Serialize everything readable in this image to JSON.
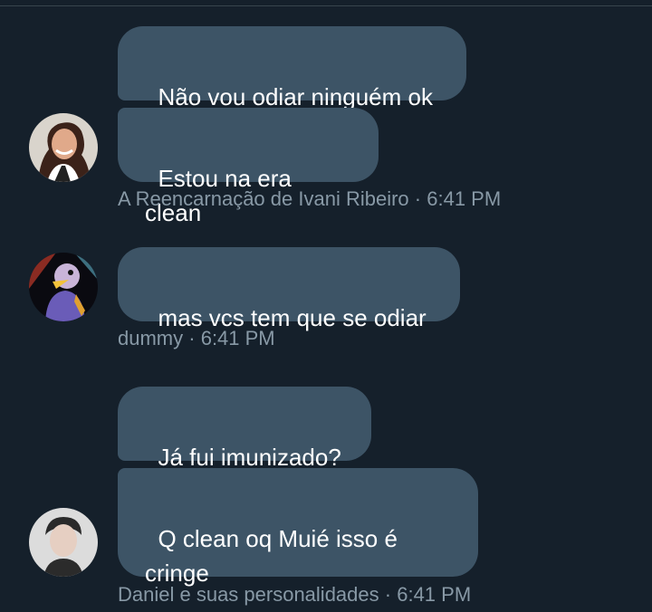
{
  "colors": {
    "background": "#15202b",
    "bubble": "#3d5466",
    "bubble_text": "#ffffff",
    "meta_text": "#8899a6"
  },
  "groups": [
    {
      "avatar": "woman-smiling-avatar",
      "messages": [
        "Não vou odiar ninguém ok",
        "Estou na era clean"
      ],
      "sender": "A Reencarnação de Ivani Ribeiro",
      "time": "6:41 PM",
      "separator": "·"
    },
    {
      "avatar": "duck-mascot-avatar",
      "messages": [
        "mas vcs tem que se odiar"
      ],
      "sender": "dummy",
      "time": "6:41 PM",
      "separator": "·"
    },
    {
      "avatar": "young-man-avatar",
      "messages": [
        "Já fui imunizado?",
        "Q clean oq Muié isso é\ncringe"
      ],
      "sender": "Daniel e suas personalidades",
      "time": "6:41 PM",
      "separator": "·"
    }
  ]
}
